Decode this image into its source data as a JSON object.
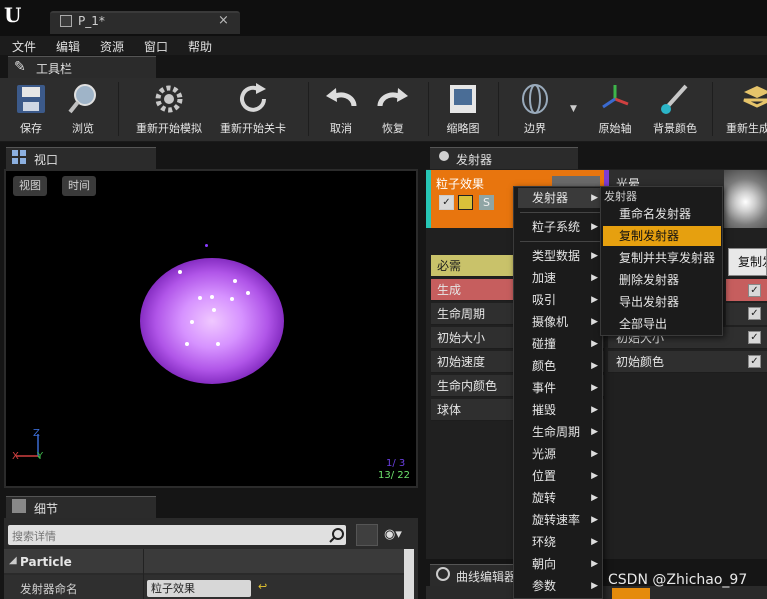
{
  "titlebar": {
    "tab_label": "P_1*",
    "close": "×"
  },
  "menu": [
    "文件",
    "编辑",
    "资源",
    "窗口",
    "帮助"
  ],
  "toolbar": {
    "panel_title": "工具栏",
    "buttons": {
      "save": "保存",
      "browse": "浏览",
      "restart_sim": "重新开始模拟",
      "restart_level": "重新开始关卡",
      "undo": "取消",
      "redo": "恢复",
      "thumbnail": "缩略图",
      "bounds": "边界",
      "origin_axis": "原始轴",
      "bg_color": "背景颜色",
      "regen": "重新生成"
    }
  },
  "viewport": {
    "panel_title": "视口",
    "view_btn": "视图",
    "time_btn": "时间",
    "stats_line1": "1/ 3",
    "stats_line2": "13/ 22",
    "axis_z": "Z",
    "axis_x": "X",
    "axis_y": "Y"
  },
  "details": {
    "panel_title": "细节",
    "search_placeholder": "搜索详情",
    "section": "Particle",
    "property_label": "发射器命名",
    "property_value": "粒子效果"
  },
  "emitters": {
    "panel_title": "发射器",
    "emitter1_name": "粒子效果",
    "emitter2_name": "光晕",
    "s_badge": "S",
    "modules_left": [
      "必需",
      "生成",
      "生命周期",
      "初始大小",
      "初始速度",
      "生命内颜色",
      "球体"
    ],
    "modules_right": [
      "初始大小",
      "初始颜色"
    ]
  },
  "curve_editor": {
    "panel_title": "曲线编辑器"
  },
  "context_menu": {
    "items": [
      "发射器",
      "粒子系统",
      "类型数据",
      "加速",
      "吸引",
      "摄像机",
      "碰撞",
      "颜色",
      "事件",
      "摧毁",
      "生命周期",
      "光源",
      "位置",
      "旋转",
      "旋转速率",
      "环绕",
      "朝向",
      "参数"
    ]
  },
  "sub_menu": {
    "header": "发射器",
    "items": [
      "重命名发射器",
      "复制发射器",
      "复制并共享发射器",
      "删除发射器",
      "导出发射器",
      "全部导出"
    ]
  },
  "tooltip": {
    "text": "复制发"
  },
  "watermark": "CSDN @Zhichao_97",
  "colors": {
    "emitter_orange": "#e8750e",
    "highlight_yellow": "#e6a00f",
    "required_row": "#c9c26a",
    "spawn_row": "#c65e5e"
  }
}
